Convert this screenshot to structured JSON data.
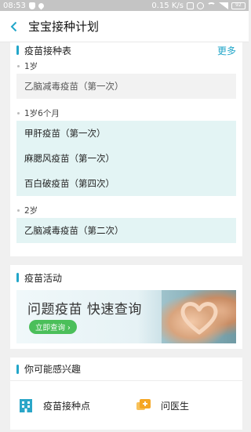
{
  "status_bar": {
    "time": "08:53",
    "network_speed": "0.15 K/s",
    "battery": "92"
  },
  "header": {
    "title": "宝宝接种计划"
  },
  "schedule": {
    "title": "疫苗接种表",
    "more_label": "更多",
    "groups": [
      {
        "age": "1岁",
        "style": "grey",
        "vaccines": [
          "乙脑减毒疫苗（第一次）"
        ]
      },
      {
        "age": "1岁6个月",
        "style": "teal",
        "vaccines": [
          "甲肝疫苗（第一次）",
          "麻腮风疫苗（第一次）",
          "百白破疫苗（第四次）"
        ]
      },
      {
        "age": "2岁",
        "style": "teal",
        "vaccines": [
          "乙脑减毒疫苗（第二次）"
        ]
      }
    ]
  },
  "activity": {
    "title": "疫苗活动",
    "banner_text": "问题疫苗 快速查询",
    "banner_button": "立即查询 ›"
  },
  "interest": {
    "title": "你可能感兴趣",
    "items": [
      {
        "label": "疫苗接种点",
        "icon": "building-icon",
        "color": "#2aa6c8"
      },
      {
        "label": "问医生",
        "icon": "chat-plus-icon",
        "color": "#f5a623"
      }
    ]
  },
  "colors": {
    "accent": "#22a6c9",
    "teal_row": "#e3f4f4",
    "grey_row": "#f2f2f2",
    "button_green": "#4bbf5a"
  }
}
